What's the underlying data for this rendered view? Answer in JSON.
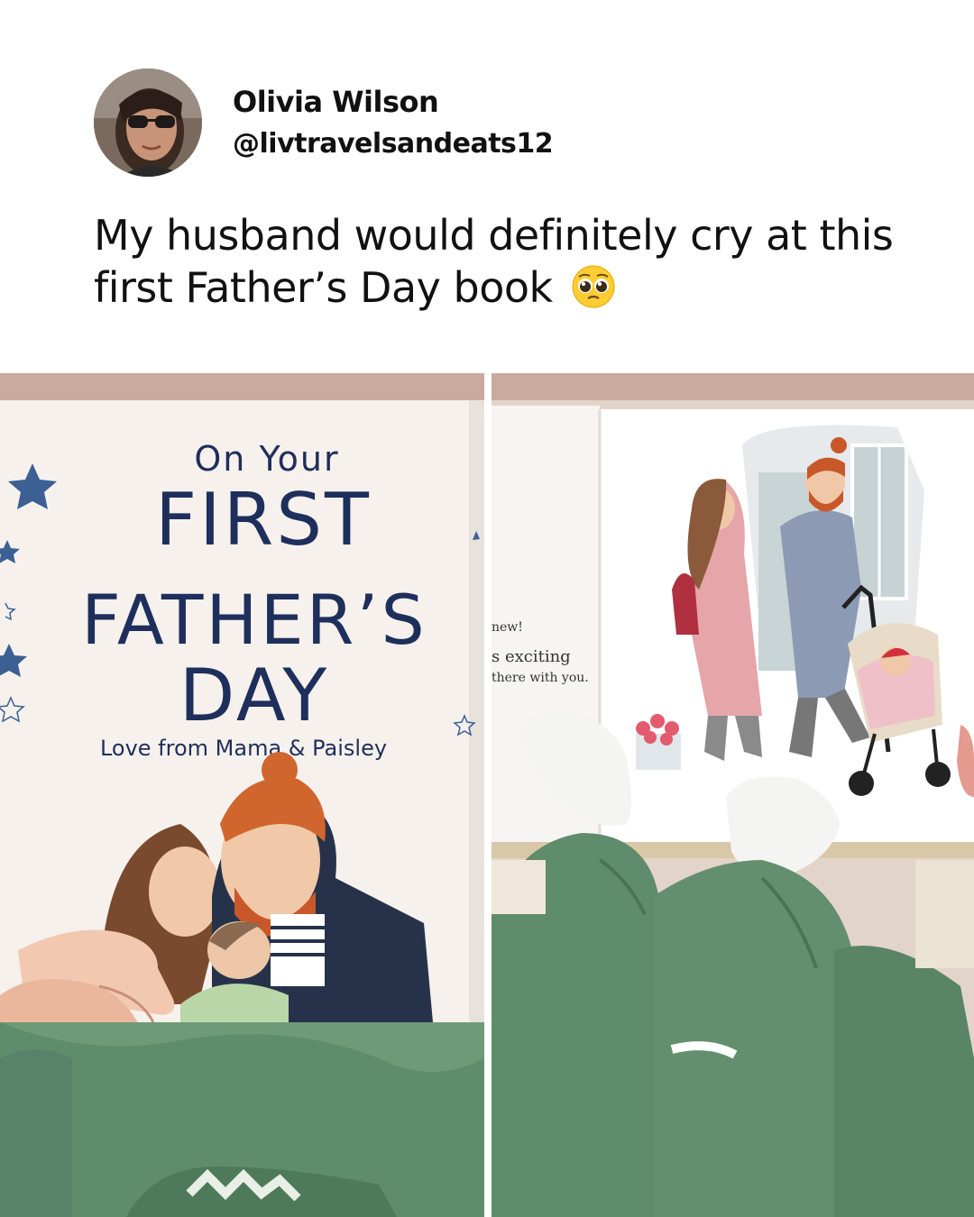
{
  "post": {
    "author_name": "Olivia Wilson",
    "author_handle": "@livtravelsandeats12",
    "text": "My husband would definitely cry at this first Father’s Day book",
    "emoji": "pleading-face-emoji"
  },
  "photos": {
    "left": {
      "cover_line1": "On Your",
      "cover_line2": "FIRST",
      "cover_line3": "FATHER’S",
      "cover_line4": "DAY",
      "cover_subtitle": "Love from Mama & Paisley"
    },
    "right": {
      "text_line1": "new!",
      "text_line2": "s exciting",
      "text_line3": "there with you."
    }
  },
  "colors": {
    "cover_navy": "#1f2f5c",
    "sweatsuit_green": "#5f8c6a",
    "background": "#ffffff"
  }
}
